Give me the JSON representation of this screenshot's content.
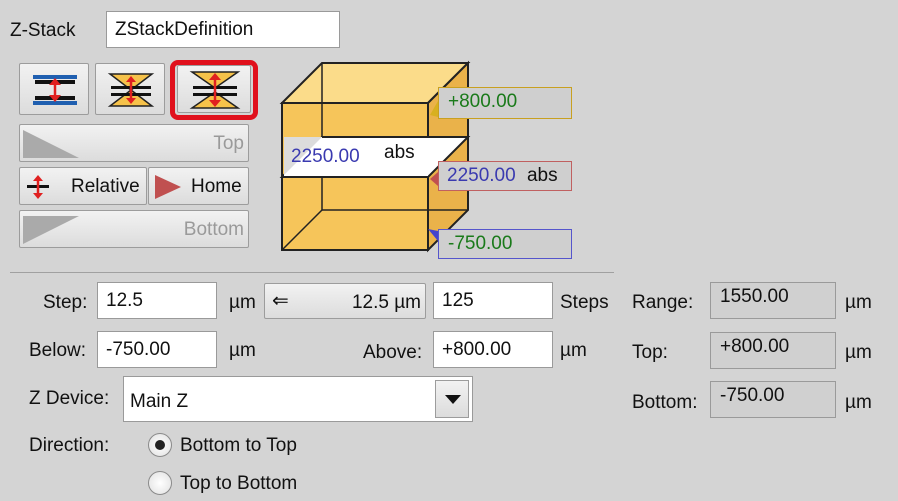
{
  "zstack": {
    "label": "Z-Stack",
    "name_value": "ZStackDefinition"
  },
  "buttons": {
    "top": "Top",
    "relative": "Relative",
    "home": "Home",
    "bottom": "Bottom",
    "step_copy": "12.5 µm"
  },
  "diagram": {
    "above_value": "+800.00",
    "current_value": "2250.00",
    "current_unit": "abs",
    "below_value": "-750.00",
    "slice_value": "2250.00",
    "slice_unit": "abs"
  },
  "form": {
    "step_label": "Step:",
    "step_value": "12.5",
    "step_unit": "µm",
    "steps_value": "125",
    "steps_label": "Steps",
    "below_label": "Below:",
    "below_value": "-750.00",
    "below_unit": "µm",
    "above_label": "Above:",
    "above_value": "+800.00",
    "above_unit": "µm",
    "zdevice_label": "Z Device:",
    "zdevice_value": "Main Z",
    "direction_label": "Direction:",
    "direction_opt1": "Bottom to Top",
    "direction_opt2": "Top to Bottom"
  },
  "summary": {
    "range_label": "Range:",
    "range_value": "1550.00",
    "top_label": "Top:",
    "top_value": "+800.00",
    "bottom_label": "Bottom:",
    "bottom_value": "-750.00",
    "unit": "µm"
  },
  "colors": {
    "cube_fill": "#f8c860",
    "selected_border": "#e0101c",
    "positive_text": "#1a7a1a",
    "position_text": "#3a3ab0"
  }
}
